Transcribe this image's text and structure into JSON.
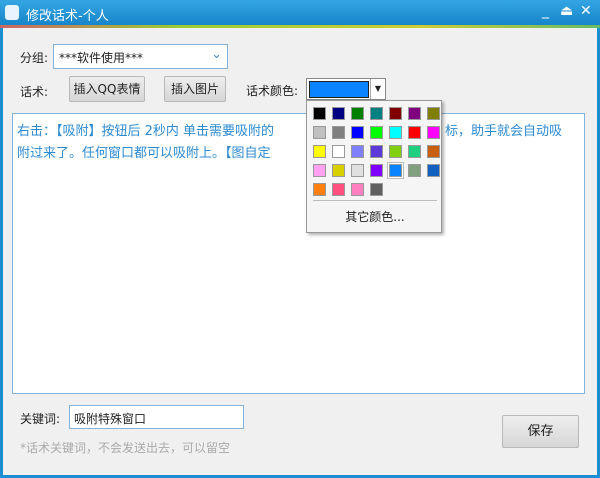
{
  "window": {
    "title": "修改话术-个人",
    "controls": [
      "_",
      "⏏",
      "✕"
    ]
  },
  "group": {
    "label": "分组:",
    "value": "***软件使用***"
  },
  "script": {
    "label": "话术:",
    "insert_emoji": "插入QQ表情",
    "insert_image": "插入图片",
    "color_label": "话术颜色:",
    "selected_color": "#0a84ff"
  },
  "content": {
    "line1a": "右击：【吸附】按钮后  2秒内 单击需要吸附的",
    "line1b": "标，助手就会自动吸",
    "line2": "附过来了。任何窗口都可以吸附上。【图自定"
  },
  "color_popup": {
    "colors": [
      "#000000",
      "#000080",
      "#008000",
      "#008080",
      "#800000",
      "#800080",
      "#808000",
      "#c0c0c0",
      "#808080",
      "#0000ff",
      "#00ff00",
      "#00ffff",
      "#ff0000",
      "#ff00ff",
      "#ffff00",
      "#ffffff",
      "#8080ff",
      "#5a3bd8",
      "#80d010",
      "#20d080",
      "#c86010",
      "#ffa0f0",
      "#d8d000",
      "#e0e0e0",
      "#8000ff",
      "#0a84ff",
      "#80a080",
      "#1060c0",
      "#ff8010",
      "#ff5080",
      "#ff80c0",
      "#606060"
    ],
    "selected_index": 25,
    "more_label": "其它颜色..."
  },
  "keyword": {
    "label": "关键词:",
    "value": "吸附特殊窗口",
    "hint": "*话术关键词，不会发送出去，可以留空"
  },
  "save_label": "保存"
}
